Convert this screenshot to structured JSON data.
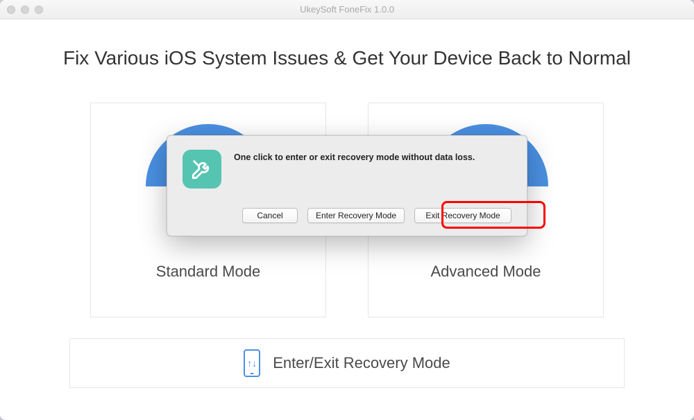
{
  "window": {
    "title": "UkeySoft FoneFix 1.0.0"
  },
  "heading": "Fix Various iOS System Issues & Get Your Device Back to Normal",
  "modes": {
    "standard": "Standard Mode",
    "advanced": "Advanced Mode"
  },
  "recovery": {
    "label": "Enter/Exit Recovery Mode"
  },
  "dialog": {
    "message": "One click to enter or exit recovery mode without data loss.",
    "cancel": "Cancel",
    "enter": "Enter Recovery Mode",
    "exit": "Exit Recovery Mode"
  },
  "icons": {
    "tools": "tools-icon",
    "phone": "phone-recovery-icon"
  }
}
